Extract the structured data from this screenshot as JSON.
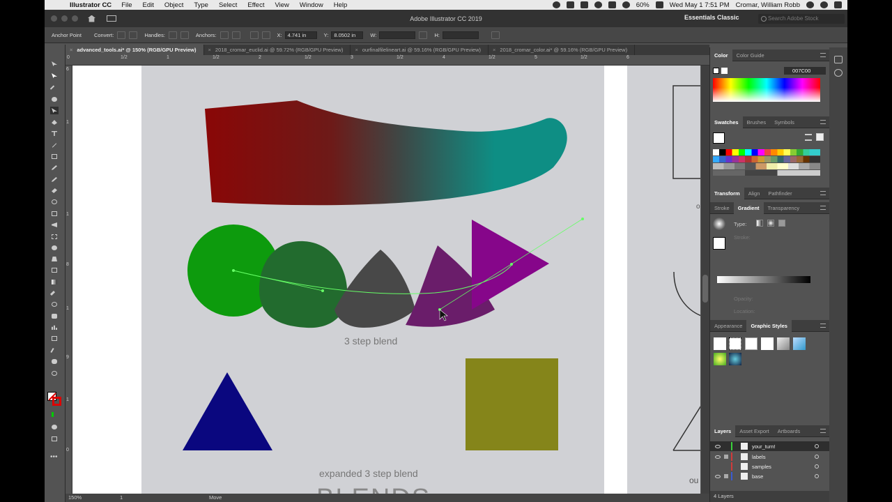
{
  "mac_menubar": {
    "app": "Illustrator CC",
    "menus": [
      "File",
      "Edit",
      "Object",
      "Type",
      "Select",
      "Effect",
      "View",
      "Window",
      "Help"
    ],
    "battery": "60%",
    "datetime": "Wed May 1  7:51 PM",
    "user": "Cromar, William Robb"
  },
  "window": {
    "title": "Adobe Illustrator CC 2019",
    "workspace": "Essentials Classic",
    "search_placeholder": "Search Adobe Stock"
  },
  "controlbar": {
    "anchor_point": "Anchor Point",
    "convert": "Convert:",
    "handles": "Handles:",
    "anchors": "Anchors:",
    "x_label": "X:",
    "x_value": "4.741 in",
    "y_label": "Y:",
    "y_value": "8.0502 in",
    "w_label": "W:",
    "h_label": "H:"
  },
  "tabs": [
    {
      "label": "advanced_tools.ai* @ 150% (RGB/GPU Preview)",
      "active": true
    },
    {
      "label": "2018_cromar_euclid.ai @ 59.72% (RGB/GPU Preview)",
      "active": false
    },
    {
      "label": "ourfinalfilelineart.ai @ 59.16% (RGB/GPU Preview)",
      "active": false
    },
    {
      "label": "2018_cromar_color.ai* @ 59.16% (RGB/GPU Preview)",
      "active": false
    }
  ],
  "ruler_h_ticks": [
    "0",
    "1/2",
    "1",
    "1/2",
    "2",
    "1/2",
    "3",
    "1/2",
    "4",
    "1/2",
    "5",
    "1/2",
    "6"
  ],
  "ruler_v_ticks": [
    "6",
    "1",
    "1",
    "8",
    "1",
    "9",
    "1",
    "0"
  ],
  "artboard": {
    "label_3step": "3 step blend",
    "label_expanded": "expanded 3 step blend",
    "heading": "BLENDS",
    "right_edge_text1": "o",
    "right_edge_text2": "ou"
  },
  "colors": {
    "gradient_red": "#8a0707",
    "gradient_teal": "#0e8e84",
    "circle_green": "#0d9b0d",
    "blend_dkgreen": "#226b2e",
    "blend_gray": "#484848",
    "blend_purple": "#6a1d6a",
    "triangle_magenta": "#86068a",
    "triangle_navy": "#0a077f",
    "square_olive": "#85851a",
    "path_lime": "#66ff66"
  },
  "panels": {
    "color_tabs": [
      "Color",
      "Color Guide"
    ],
    "hex_value": "007C00",
    "swatch_tabs": [
      "Swatches",
      "Brushes",
      "Symbols"
    ],
    "transform_tabs": [
      "Transform",
      "Align",
      "Pathfinder"
    ],
    "stroke_tabs": [
      "Stroke",
      "Gradient",
      "Transparency"
    ],
    "gradient_type_label": "Type:",
    "gradient_stroke_label": "Stroke:",
    "gradient_opacity_label": "Opacity:",
    "gradient_location_label": "Location:",
    "appearance_tabs": [
      "Appearance",
      "Graphic Styles"
    ],
    "layers_tabs": [
      "Layers",
      "Asset Export",
      "Artboards"
    ],
    "layers": [
      {
        "name": "your_turn!",
        "color": "#3bd13b",
        "locked": false,
        "selected": true
      },
      {
        "name": "labels",
        "color": "#d13b3b",
        "locked": true,
        "selected": false
      },
      {
        "name": "samples",
        "color": "#d13b3b",
        "locked": false,
        "selected": false
      },
      {
        "name": "base",
        "color": "#3b5bd1",
        "locked": true,
        "selected": false
      }
    ],
    "layers_count": "4 Layers"
  },
  "status": {
    "zoom": "150%",
    "artboard_num": "1",
    "tool_label": "Move"
  }
}
